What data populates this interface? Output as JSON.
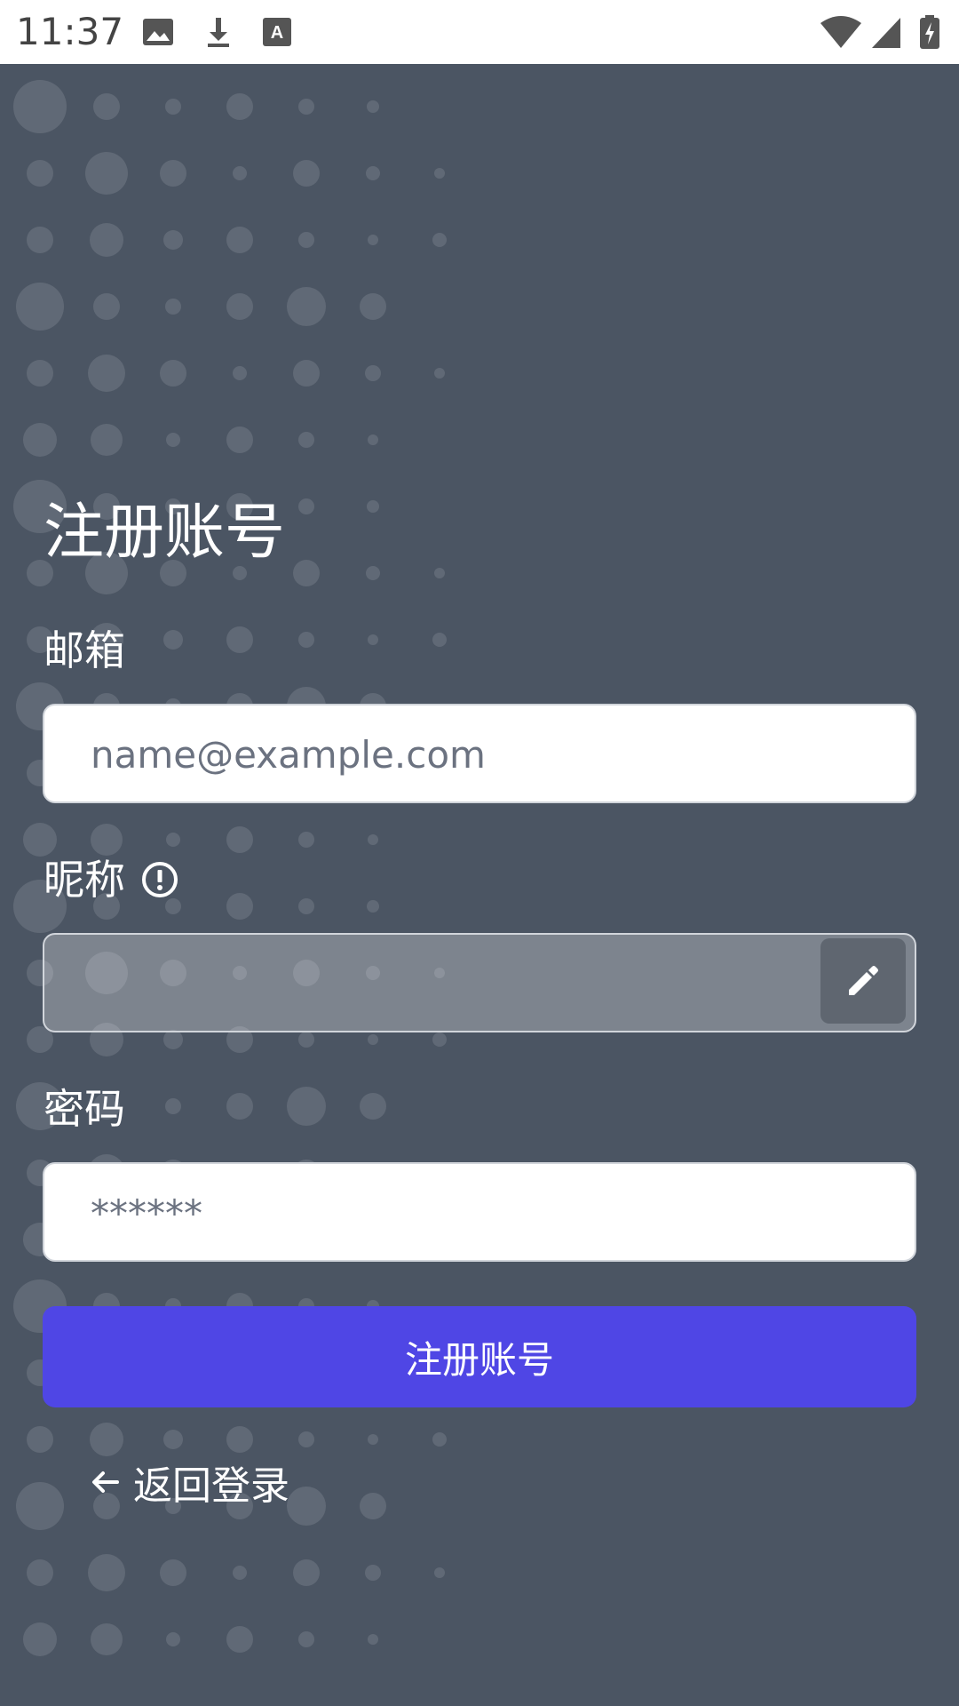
{
  "status_bar": {
    "time": "11:37",
    "left_icons": [
      "image-icon",
      "download-icon",
      "font-icon"
    ],
    "right_icons": [
      "wifi-icon",
      "signal-icon",
      "battery-icon"
    ]
  },
  "page": {
    "title": "注册账号",
    "background_color": "#4b5563",
    "accent_color": "#4f46e5"
  },
  "form": {
    "email": {
      "label": "邮箱",
      "placeholder": "name@example.com",
      "value": ""
    },
    "nickname": {
      "label": "昵称",
      "value": "",
      "info_icon": "info-circle-icon",
      "edit_icon": "pencil-icon"
    },
    "password": {
      "label": "密码",
      "placeholder": "******",
      "value": ""
    },
    "submit_label": "注册账号",
    "back_label": "返回登录",
    "back_icon": "arrow-left-icon"
  }
}
